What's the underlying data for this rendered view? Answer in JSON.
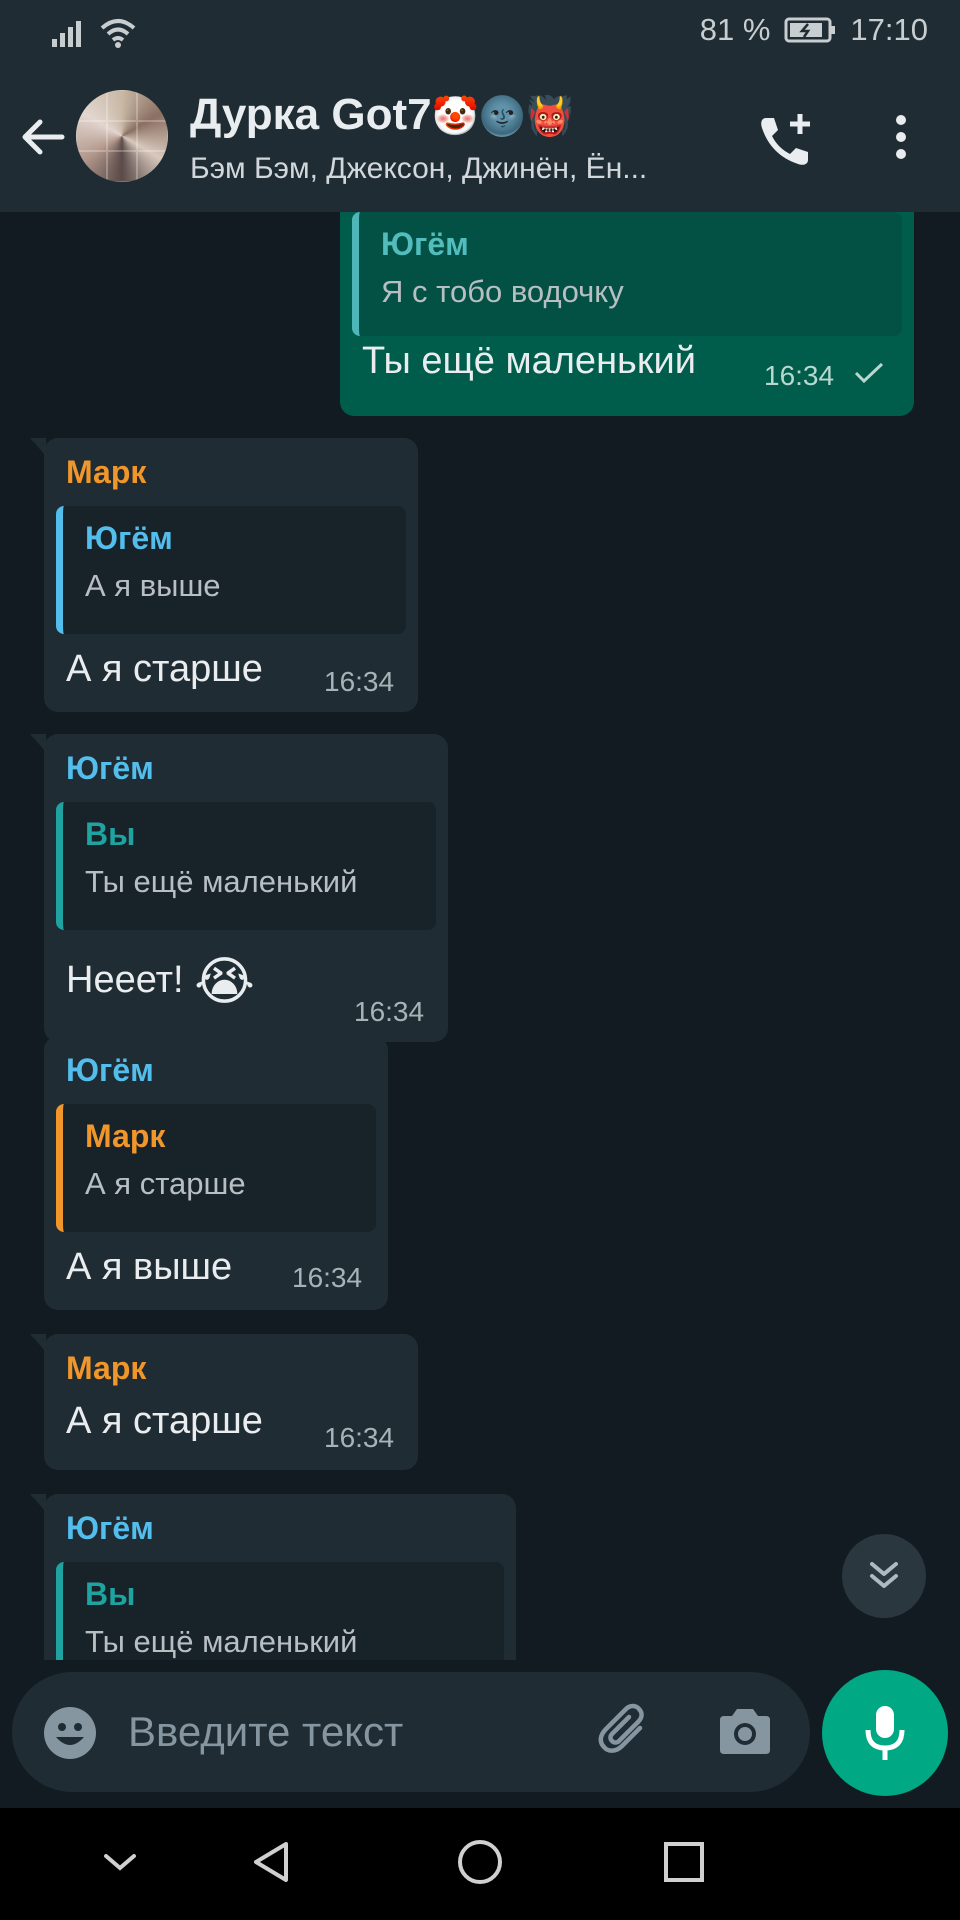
{
  "status_bar": {
    "battery": "81 %",
    "time": "17:10",
    "icons": [
      "signal-icon",
      "wifi-icon",
      "battery-icon"
    ]
  },
  "header": {
    "title": "Дурка Got7",
    "title_emoji": "🤡🌚👹",
    "members": "Бэм Бэм, Джексон, Джинён, Ён...",
    "icons": [
      "back-arrow-icon",
      "group-avatar",
      "add-call-icon",
      "more-vert-icon"
    ]
  },
  "colors": {
    "background": "#121b22",
    "bubble_in": "#202c33",
    "bubble_out": "#005c4b",
    "accent": "#00a884",
    "name_mark": "#f0962b",
    "name_yugyeom": "#53bdeb",
    "name_you": "#1fa3a0"
  },
  "messages": [
    {
      "direction": "out",
      "quote": {
        "name": "Югём",
        "text": "Я с тобо водочку"
      },
      "text": "Ты ещё маленький",
      "time": "16:34",
      "status": "sent"
    },
    {
      "direction": "in",
      "sender": "Марк",
      "quote": {
        "name": "Югём",
        "text": "А я выше"
      },
      "text": "А я старше",
      "time": "16:34"
    },
    {
      "direction": "in",
      "sender": "Югём",
      "quote": {
        "name": "Вы",
        "text": "Ты ещё маленький"
      },
      "text": "Нееет!",
      "emoji": "😭",
      "time": "16:34"
    },
    {
      "direction": "in",
      "sender": "Югём",
      "quote": {
        "name": "Марк",
        "text": "А я старше"
      },
      "text": "А я выше",
      "time": "16:34"
    },
    {
      "direction": "in",
      "sender": "Марк",
      "text": "А я старше",
      "time": "16:34"
    },
    {
      "direction": "in",
      "sender": "Югём",
      "quote": {
        "name": "Вы",
        "text": "Ты ещё маленький"
      }
    }
  ],
  "input": {
    "placeholder": "Введите текст",
    "icons": [
      "emoji-icon",
      "attach-icon",
      "camera-icon",
      "mic-icon"
    ]
  },
  "nav_bar": {
    "icons": [
      "nav-hide-icon",
      "nav-back-icon",
      "nav-home-icon",
      "nav-recents-icon"
    ]
  }
}
